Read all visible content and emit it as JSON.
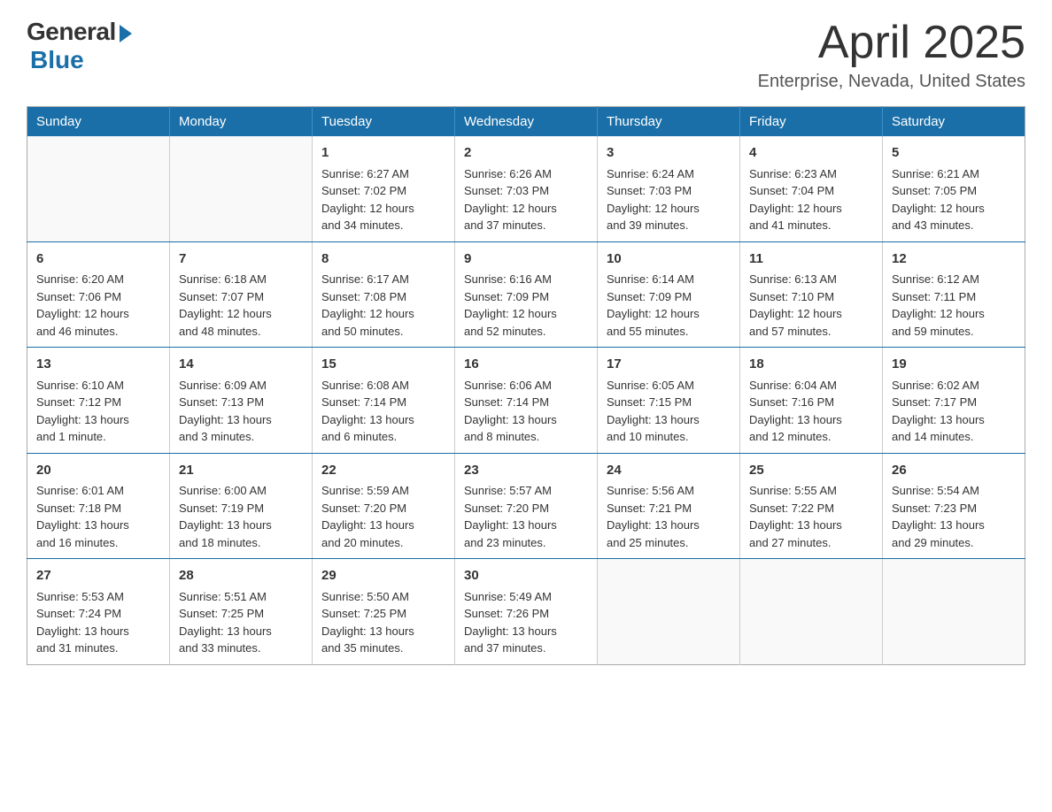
{
  "header": {
    "logo_general": "General",
    "logo_blue": "Blue",
    "title_month": "April 2025",
    "title_location": "Enterprise, Nevada, United States"
  },
  "calendar": {
    "days_of_week": [
      "Sunday",
      "Monday",
      "Tuesday",
      "Wednesday",
      "Thursday",
      "Friday",
      "Saturday"
    ],
    "weeks": [
      [
        {
          "day": "",
          "info": ""
        },
        {
          "day": "",
          "info": ""
        },
        {
          "day": "1",
          "info": "Sunrise: 6:27 AM\nSunset: 7:02 PM\nDaylight: 12 hours\nand 34 minutes."
        },
        {
          "day": "2",
          "info": "Sunrise: 6:26 AM\nSunset: 7:03 PM\nDaylight: 12 hours\nand 37 minutes."
        },
        {
          "day": "3",
          "info": "Sunrise: 6:24 AM\nSunset: 7:03 PM\nDaylight: 12 hours\nand 39 minutes."
        },
        {
          "day": "4",
          "info": "Sunrise: 6:23 AM\nSunset: 7:04 PM\nDaylight: 12 hours\nand 41 minutes."
        },
        {
          "day": "5",
          "info": "Sunrise: 6:21 AM\nSunset: 7:05 PM\nDaylight: 12 hours\nand 43 minutes."
        }
      ],
      [
        {
          "day": "6",
          "info": "Sunrise: 6:20 AM\nSunset: 7:06 PM\nDaylight: 12 hours\nand 46 minutes."
        },
        {
          "day": "7",
          "info": "Sunrise: 6:18 AM\nSunset: 7:07 PM\nDaylight: 12 hours\nand 48 minutes."
        },
        {
          "day": "8",
          "info": "Sunrise: 6:17 AM\nSunset: 7:08 PM\nDaylight: 12 hours\nand 50 minutes."
        },
        {
          "day": "9",
          "info": "Sunrise: 6:16 AM\nSunset: 7:09 PM\nDaylight: 12 hours\nand 52 minutes."
        },
        {
          "day": "10",
          "info": "Sunrise: 6:14 AM\nSunset: 7:09 PM\nDaylight: 12 hours\nand 55 minutes."
        },
        {
          "day": "11",
          "info": "Sunrise: 6:13 AM\nSunset: 7:10 PM\nDaylight: 12 hours\nand 57 minutes."
        },
        {
          "day": "12",
          "info": "Sunrise: 6:12 AM\nSunset: 7:11 PM\nDaylight: 12 hours\nand 59 minutes."
        }
      ],
      [
        {
          "day": "13",
          "info": "Sunrise: 6:10 AM\nSunset: 7:12 PM\nDaylight: 13 hours\nand 1 minute."
        },
        {
          "day": "14",
          "info": "Sunrise: 6:09 AM\nSunset: 7:13 PM\nDaylight: 13 hours\nand 3 minutes."
        },
        {
          "day": "15",
          "info": "Sunrise: 6:08 AM\nSunset: 7:14 PM\nDaylight: 13 hours\nand 6 minutes."
        },
        {
          "day": "16",
          "info": "Sunrise: 6:06 AM\nSunset: 7:14 PM\nDaylight: 13 hours\nand 8 minutes."
        },
        {
          "day": "17",
          "info": "Sunrise: 6:05 AM\nSunset: 7:15 PM\nDaylight: 13 hours\nand 10 minutes."
        },
        {
          "day": "18",
          "info": "Sunrise: 6:04 AM\nSunset: 7:16 PM\nDaylight: 13 hours\nand 12 minutes."
        },
        {
          "day": "19",
          "info": "Sunrise: 6:02 AM\nSunset: 7:17 PM\nDaylight: 13 hours\nand 14 minutes."
        }
      ],
      [
        {
          "day": "20",
          "info": "Sunrise: 6:01 AM\nSunset: 7:18 PM\nDaylight: 13 hours\nand 16 minutes."
        },
        {
          "day": "21",
          "info": "Sunrise: 6:00 AM\nSunset: 7:19 PM\nDaylight: 13 hours\nand 18 minutes."
        },
        {
          "day": "22",
          "info": "Sunrise: 5:59 AM\nSunset: 7:20 PM\nDaylight: 13 hours\nand 20 minutes."
        },
        {
          "day": "23",
          "info": "Sunrise: 5:57 AM\nSunset: 7:20 PM\nDaylight: 13 hours\nand 23 minutes."
        },
        {
          "day": "24",
          "info": "Sunrise: 5:56 AM\nSunset: 7:21 PM\nDaylight: 13 hours\nand 25 minutes."
        },
        {
          "day": "25",
          "info": "Sunrise: 5:55 AM\nSunset: 7:22 PM\nDaylight: 13 hours\nand 27 minutes."
        },
        {
          "day": "26",
          "info": "Sunrise: 5:54 AM\nSunset: 7:23 PM\nDaylight: 13 hours\nand 29 minutes."
        }
      ],
      [
        {
          "day": "27",
          "info": "Sunrise: 5:53 AM\nSunset: 7:24 PM\nDaylight: 13 hours\nand 31 minutes."
        },
        {
          "day": "28",
          "info": "Sunrise: 5:51 AM\nSunset: 7:25 PM\nDaylight: 13 hours\nand 33 minutes."
        },
        {
          "day": "29",
          "info": "Sunrise: 5:50 AM\nSunset: 7:25 PM\nDaylight: 13 hours\nand 35 minutes."
        },
        {
          "day": "30",
          "info": "Sunrise: 5:49 AM\nSunset: 7:26 PM\nDaylight: 13 hours\nand 37 minutes."
        },
        {
          "day": "",
          "info": ""
        },
        {
          "day": "",
          "info": ""
        },
        {
          "day": "",
          "info": ""
        }
      ]
    ]
  }
}
